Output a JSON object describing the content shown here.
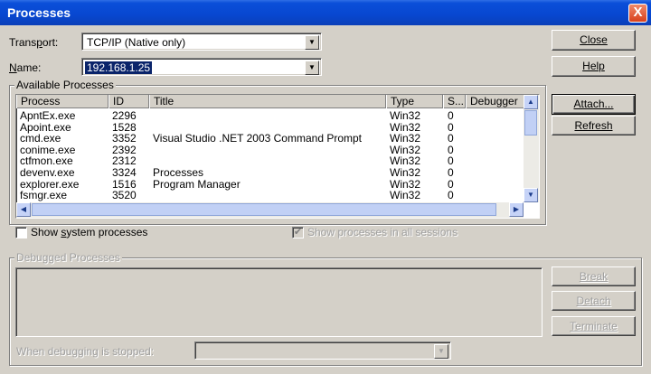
{
  "window": {
    "title": "Processes",
    "close_glyph": "X"
  },
  "transport": {
    "label_pre": "Trans",
    "label_key": "p",
    "label_post": "ort:",
    "value": "TCP/IP (Native only)"
  },
  "name": {
    "label_key": "N",
    "label_post": "ame:",
    "value": "192.168.1.25"
  },
  "buttons": {
    "close": "Close",
    "help": "Help",
    "attach": "Attach...",
    "refresh": "Refresh",
    "break": "Break",
    "detach": "Detach",
    "terminate": "Terminate"
  },
  "available": {
    "title": "Available Processes",
    "columns": [
      "Process",
      "ID",
      "Title",
      "Type",
      "S...",
      "Debugger"
    ],
    "rows": [
      {
        "process": "ApntEx.exe",
        "id": "2296",
        "title": "",
        "type": "Win32",
        "s": "0"
      },
      {
        "process": "Apoint.exe",
        "id": "1528",
        "title": "",
        "type": "Win32",
        "s": "0"
      },
      {
        "process": "cmd.exe",
        "id": "3352",
        "title": "Visual Studio .NET 2003 Command Prompt",
        "type": "Win32",
        "s": "0"
      },
      {
        "process": "conime.exe",
        "id": "2392",
        "title": "",
        "type": "Win32",
        "s": "0"
      },
      {
        "process": "ctfmon.exe",
        "id": "2312",
        "title": "",
        "type": "Win32",
        "s": "0"
      },
      {
        "process": "devenv.exe",
        "id": "3324",
        "title": "Processes",
        "type": "Win32",
        "s": "0"
      },
      {
        "process": "explorer.exe",
        "id": "1516",
        "title": "Program Manager",
        "type": "Win32",
        "s": "0"
      },
      {
        "process": "fsmgr.exe",
        "id": "3520",
        "title": "",
        "type": "Win32",
        "s": "0"
      }
    ]
  },
  "checkboxes": {
    "show_system": {
      "pre": "Show ",
      "key": "s",
      "post": "ystem processes",
      "checked": false
    },
    "show_all_sessions": {
      "label": "Show processes in all sessions",
      "checked": true
    }
  },
  "debugged": {
    "title": "Debugged Processes"
  },
  "when_stopped": {
    "label": "When debugging is stopped:",
    "value": ""
  }
}
